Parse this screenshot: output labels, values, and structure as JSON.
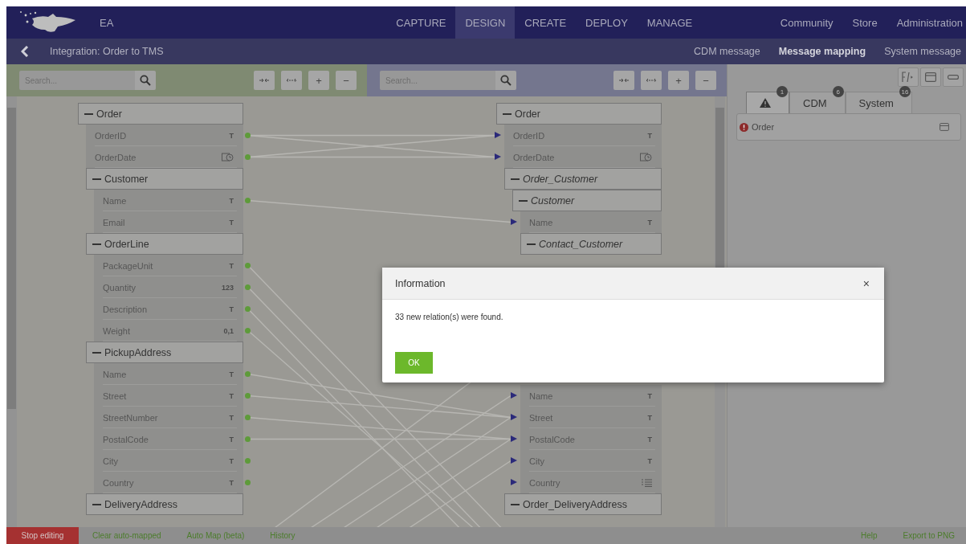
{
  "app": {
    "name": "EA"
  },
  "nav": [
    {
      "label": "CAPTURE",
      "selected": false
    },
    {
      "label": "DESIGN",
      "selected": true
    },
    {
      "label": "CREATE",
      "selected": false
    },
    {
      "label": "DEPLOY",
      "selected": false
    },
    {
      "label": "MANAGE",
      "selected": false
    }
  ],
  "nav_right": [
    "Community",
    "Store",
    "Administration"
  ],
  "breadcrumb": "Integration: Order to TMS",
  "views": [
    {
      "label": "CDM message",
      "selected": false
    },
    {
      "label": "Message mapping",
      "selected": true
    },
    {
      "label": "System message",
      "selected": false
    }
  ],
  "source": {
    "search": {
      "placeholder": "Search..."
    },
    "tools": [
      {
        "kind": "collapse"
      },
      {
        "kind": "expand"
      },
      {
        "kind": "text",
        "label": "+"
      },
      {
        "kind": "text",
        "label": "−"
      }
    ],
    "tree": [
      {
        "kind": "group",
        "name": "Order",
        "italic": false,
        "children": [
          {
            "kind": "field",
            "name": "OrderID",
            "type": {
              "kind": "text",
              "label": "T"
            },
            "mapped": true
          },
          {
            "kind": "field",
            "name": "OrderDate",
            "type": {
              "kind": "date"
            },
            "mapped": true
          },
          {
            "kind": "group",
            "name": "Customer",
            "italic": false,
            "children": [
              {
                "kind": "field",
                "name": "Name",
                "type": {
                  "kind": "text",
                  "label": "T"
                },
                "mapped": true
              },
              {
                "kind": "field",
                "name": "Email",
                "type": {
                  "kind": "text",
                  "label": "T"
                },
                "mapped": false
              }
            ]
          },
          {
            "kind": "group",
            "name": "OrderLine",
            "italic": false,
            "children": [
              {
                "kind": "field",
                "name": "PackageUnit",
                "type": {
                  "kind": "text",
                  "label": "T"
                },
                "mapped": true
              },
              {
                "kind": "field",
                "name": "Quantity",
                "type": {
                  "kind": "text",
                  "label": "123"
                },
                "mapped": true
              },
              {
                "kind": "field",
                "name": "Description",
                "type": {
                  "kind": "text",
                  "label": "T"
                },
                "mapped": true
              },
              {
                "kind": "field",
                "name": "Weight",
                "type": {
                  "kind": "text",
                  "label": "0,1"
                },
                "mapped": true
              }
            ]
          },
          {
            "kind": "group",
            "name": "PickupAddress",
            "italic": false,
            "children": [
              {
                "kind": "field",
                "name": "Name",
                "type": {
                  "kind": "text",
                  "label": "T"
                },
                "mapped": true
              },
              {
                "kind": "field",
                "name": "Street",
                "type": {
                  "kind": "text",
                  "label": "T"
                },
                "mapped": true
              },
              {
                "kind": "field",
                "name": "StreetNumber",
                "type": {
                  "kind": "text",
                  "label": "T"
                },
                "mapped": true
              },
              {
                "kind": "field",
                "name": "PostalCode",
                "type": {
                  "kind": "text",
                  "label": "T"
                },
                "mapped": true
              },
              {
                "kind": "field",
                "name": "City",
                "type": {
                  "kind": "text",
                  "label": "T"
                },
                "mapped": true
              },
              {
                "kind": "field",
                "name": "Country",
                "type": {
                  "kind": "text",
                  "label": "T"
                },
                "mapped": true
              }
            ]
          },
          {
            "kind": "group",
            "name": "DeliveryAddress",
            "italic": false
          }
        ]
      }
    ]
  },
  "target": {
    "search": {
      "placeholder": "Search..."
    },
    "tools": [
      {
        "kind": "collapse"
      },
      {
        "kind": "expand"
      },
      {
        "kind": "text",
        "label": "+"
      },
      {
        "kind": "text",
        "label": "−"
      }
    ],
    "tree": [
      {
        "kind": "group",
        "name": "Order",
        "italic": false,
        "children": [
          {
            "kind": "field",
            "name": "OrderID",
            "type": {
              "kind": "text",
              "label": "T"
            },
            "mapped": true
          },
          {
            "kind": "field",
            "name": "OrderDate",
            "type": {
              "kind": "date"
            },
            "mapped": true
          },
          {
            "kind": "group",
            "name": "Order_Customer",
            "italic": true,
            "children": [
              {
                "kind": "group",
                "name": "Customer",
                "italic": true,
                "children": [
                  {
                    "kind": "field",
                    "name": "Name",
                    "type": {
                      "kind": "text",
                      "label": "T"
                    },
                    "mapped": true
                  },
                  {
                    "kind": "group",
                    "name": "Contact_Customer",
                    "italic": true
                  }
                ]
              }
            ]
          }
        ]
      }
    ],
    "tree_lower": [
      {
        "kind": "field",
        "name": "Name",
        "type": {
          "kind": "text",
          "label": "T"
        },
        "mapped": true
      },
      {
        "kind": "field",
        "name": "Street",
        "type": {
          "kind": "text",
          "label": "T"
        },
        "mapped": true
      },
      {
        "kind": "field",
        "name": "PostalCode",
        "type": {
          "kind": "text",
          "label": "T"
        },
        "mapped": true
      },
      {
        "kind": "field",
        "name": "City",
        "type": {
          "kind": "text",
          "label": "T"
        },
        "mapped": true
      },
      {
        "kind": "field",
        "name": "Country",
        "type": {
          "kind": "list"
        },
        "mapped": true
      },
      {
        "kind": "group",
        "name": "Order_DeliveryAddress",
        "italic": false
      }
    ]
  },
  "side_tools": [
    {
      "kind": "formula"
    },
    {
      "kind": "window"
    },
    {
      "kind": "minimize"
    }
  ],
  "side_tabs": [
    {
      "kind": "warning",
      "badge": "1",
      "selected": true
    },
    {
      "kind": "text",
      "label": "CDM",
      "badge": "6",
      "selected": false
    },
    {
      "kind": "text",
      "label": "System",
      "badge": "16",
      "selected": false
    }
  ],
  "issues": [
    {
      "kind": "error",
      "label": "Order"
    }
  ],
  "dialog": {
    "title": "Information",
    "close": "×",
    "message": "33 new relation(s) were found.",
    "button": "OK"
  },
  "footer": {
    "left": [
      {
        "kind": "danger",
        "label": "Stop editing"
      },
      {
        "kind": "link",
        "label": "Clear auto-mapped"
      },
      {
        "kind": "link",
        "label": "Auto Map (beta)"
      },
      {
        "kind": "link",
        "label": "History"
      }
    ],
    "right": [
      "Help",
      "Export to PNG"
    ]
  }
}
